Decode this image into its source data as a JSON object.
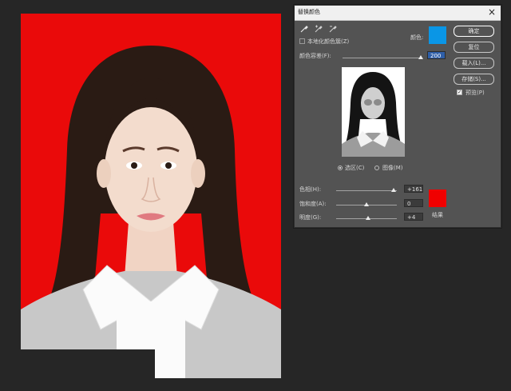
{
  "dialog": {
    "title": "替换颜色",
    "close_label": "×",
    "localized_clusters_label": "本地化颜色簇(Z)",
    "color_label": "颜色:",
    "fuzziness_label": "颜色容差(F):",
    "fuzziness_value": "200",
    "fuzziness_level": 1.0,
    "preview_mode_selection_label": "选区(C)",
    "preview_mode_image_label": "图像(M)",
    "preview_mode_selected": "selection",
    "buttons": {
      "ok": "确定",
      "reset": "复位",
      "load": "载入(L)...",
      "save": "存储(S)..."
    },
    "preview_checkbox_label": "预览(P)",
    "preview_checked": true,
    "replacement": {
      "hue_label": "色相(H):",
      "hue_value": "+161",
      "hue_level": 0.95,
      "saturation_label": "饱和度(A):",
      "saturation_value": "0",
      "saturation_level": 0.5,
      "lightness_label": "明度(G):",
      "lightness_value": "+4",
      "lightness_level": 0.52,
      "result_label": "结果"
    },
    "colors": {
      "sampled_color": "#0a96e6",
      "result_color": "#f00000",
      "photo_background": "#ea0a0a"
    },
    "tools": [
      "eyedropper-icon",
      "eyedropper-plus-icon",
      "eyedropper-minus-icon"
    ]
  }
}
